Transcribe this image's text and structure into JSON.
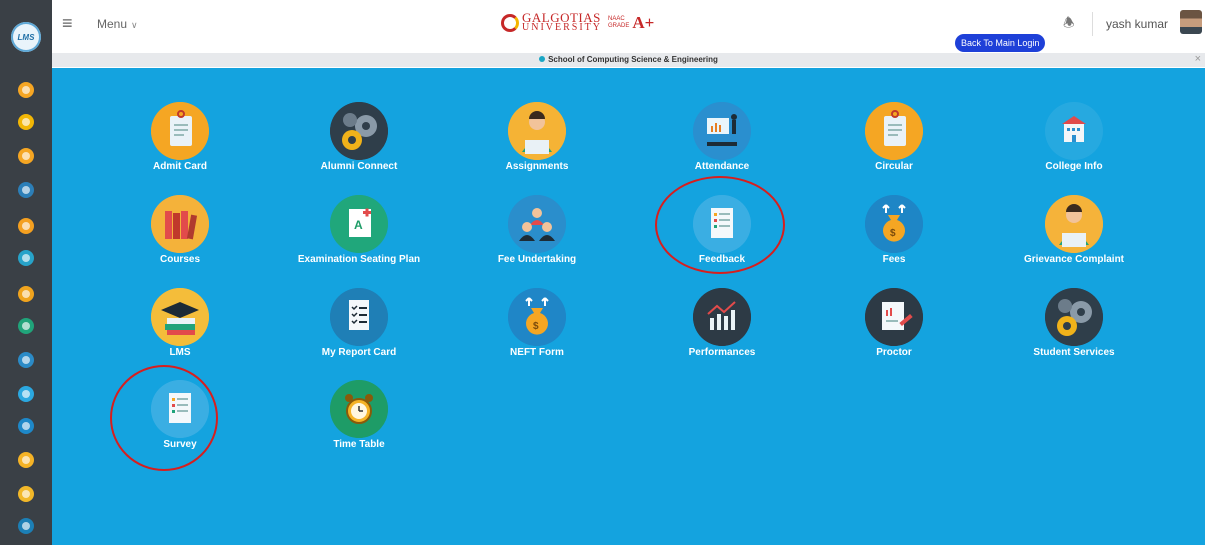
{
  "topbar": {
    "menu_label": "Menu",
    "brand_line1": "GALGOTIAS",
    "brand_line2": "UNIVERSITY",
    "naac_line1": "NAAC",
    "naac_line2": "GRADE",
    "grade": "A+",
    "back_button_label": "Back To Main Login",
    "username": "yash kumar"
  },
  "school_banner": "School of Computing Science & Engineering",
  "rail_logo": "LMS",
  "rail_icons": [
    {
      "icon": "clipboard-icon",
      "color": "#f6a623"
    },
    {
      "icon": "gears-icon",
      "color": "#f2b705"
    },
    {
      "icon": "person-icon",
      "color": "#f5a623"
    },
    {
      "icon": "chart-icon",
      "color": "#2c7fb8"
    },
    {
      "icon": "notice-icon",
      "color": "#f4a020"
    },
    {
      "icon": "building-icon",
      "color": "#27a3c9"
    },
    {
      "icon": "books-icon",
      "color": "#f0a41e"
    },
    {
      "icon": "exam-icon",
      "color": "#20a47a"
    },
    {
      "icon": "people-icon",
      "color": "#2b8bc7"
    },
    {
      "icon": "form-icon",
      "color": "#2ba8e0"
    },
    {
      "icon": "fees-icon",
      "color": "#1e88c8"
    },
    {
      "icon": "complaint-icon",
      "color": "#f5b326"
    },
    {
      "icon": "lms-icon",
      "color": "#f2b829"
    },
    {
      "icon": "report-icon",
      "color": "#1c7fb5"
    }
  ],
  "tiles": [
    {
      "label": "Admit Card",
      "icon": "admit-card-icon",
      "bg": "#f5a623"
    },
    {
      "label": "Alumni Connect",
      "icon": "gears-icon",
      "bg": "#2f3e4a"
    },
    {
      "label": "Assignments",
      "icon": "student-laptop-icon",
      "bg": "#f5b335"
    },
    {
      "label": "Attendance",
      "icon": "presentation-icon",
      "bg": "#2a8fcf"
    },
    {
      "label": "Circular",
      "icon": "notice-icon",
      "bg": "#f5a623"
    },
    {
      "label": "College Info",
      "icon": "building-icon",
      "bg": "#26a9e0"
    },
    {
      "label": "Courses",
      "icon": "books-icon",
      "bg": "#f4b23a"
    },
    {
      "label": "Examination Seating Plan",
      "icon": "exam-sheet-icon",
      "bg": "#20a77b"
    },
    {
      "label": "Fee Undertaking",
      "icon": "people-group-icon",
      "bg": "#2a8ecc"
    },
    {
      "label": "Feedback",
      "icon": "form-icon",
      "bg": "#3aaee3"
    },
    {
      "label": "Fees",
      "icon": "money-bag-icon",
      "bg": "#1e86c6"
    },
    {
      "label": "Grievance Complaint",
      "icon": "person-laptop-icon",
      "bg": "#f5b33a"
    },
    {
      "label": "LMS",
      "icon": "graduation-cap-icon",
      "bg": "#f4bd3a"
    },
    {
      "label": "My Report Card",
      "icon": "checklist-icon",
      "bg": "#1f7fb6"
    },
    {
      "label": "NEFT Form",
      "icon": "money-bag-icon",
      "bg": "#1f86c7"
    },
    {
      "label": "Performances",
      "icon": "line-chart-icon",
      "bg": "#2d3a45"
    },
    {
      "label": "Proctor",
      "icon": "report-pen-icon",
      "bg": "#2d3a45"
    },
    {
      "label": "Student Services",
      "icon": "gears-icon",
      "bg": "#2f3e4a"
    },
    {
      "label": "Survey",
      "icon": "form-icon",
      "bg": "#3aaee3"
    },
    {
      "label": "Time Table",
      "icon": "alarm-clock-icon",
      "bg": "#1e9c67"
    }
  ]
}
